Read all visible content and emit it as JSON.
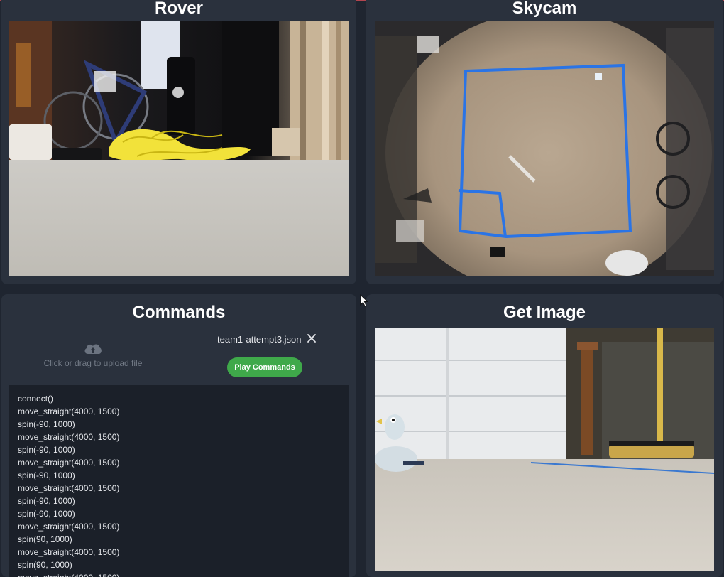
{
  "panels": {
    "rover": {
      "title": "Rover"
    },
    "skycam": {
      "title": "Skycam"
    },
    "commands": {
      "title": "Commands",
      "upload_hint": "Click or drag to upload file",
      "file_name": "team1-attempt3.json",
      "play_label": "Play Commands",
      "lines": [
        "connect()",
        "move_straight(4000, 1500)",
        "spin(-90, 1000)",
        "move_straight(4000, 1500)",
        "spin(-90, 1000)",
        "move_straight(4000, 1500)",
        "spin(-90, 1000)",
        "move_straight(4000, 1500)",
        "spin(-90, 1000)",
        "spin(-90, 1000)",
        "move_straight(4000, 1500)",
        "spin(90, 1000)",
        "move_straight(4000, 1500)",
        "spin(90, 1000)",
        "move_straight(4000, 1500)"
      ]
    },
    "get_image": {
      "title": "Get Image"
    }
  },
  "icons": {
    "upload": "cloud-upload-icon",
    "close": "close-icon",
    "cursor": "mouse-pointer-icon"
  },
  "colors": {
    "background": "#1f2530",
    "panel": "#2a313d",
    "command_list_bg": "#1b2029",
    "play_button": "#3fa94a",
    "tape_blue": "#2a74e6",
    "accent": "#b3454f"
  }
}
